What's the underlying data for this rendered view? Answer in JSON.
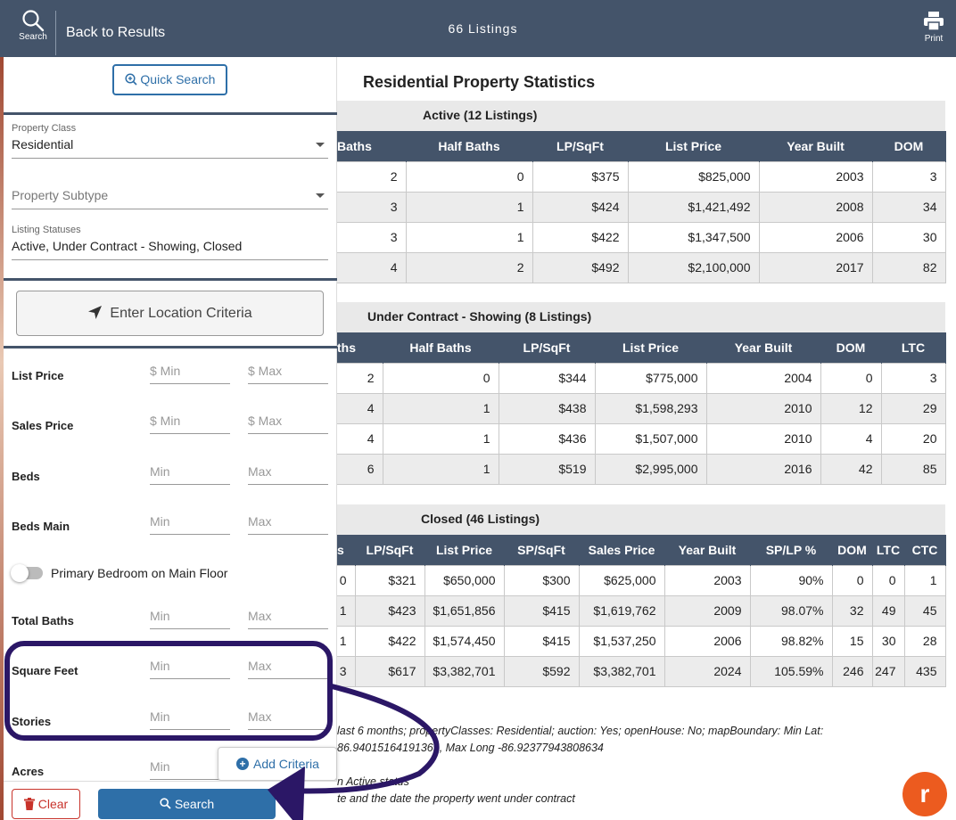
{
  "topbar": {
    "search_label": "Search",
    "back_label": "Back to Results",
    "listing_count": "66 Listings",
    "print_label": "Print"
  },
  "panel": {
    "quick_search": "Quick Search",
    "property_class": {
      "label": "Property Class",
      "value": "Residential"
    },
    "property_subtype": {
      "placeholder": "Property Subtype"
    },
    "listing_statuses": {
      "label": "Listing Statuses",
      "value": "Active, Under Contract - Showing, Closed"
    },
    "location_button": "Enter Location Criteria",
    "ranges": [
      {
        "label": "List Price",
        "min": "$  Min",
        "max": "$  Max"
      },
      {
        "label": "Sales Price",
        "min": "$  Min",
        "max": "$  Max"
      },
      {
        "label": "Beds",
        "min": "Min",
        "max": "Max"
      },
      {
        "label": "Beds Main",
        "min": "Min",
        "max": "Max"
      },
      {
        "label": "Total Baths",
        "min": "Min",
        "max": "Max"
      },
      {
        "label": "Square Feet",
        "min": "Min",
        "max": "Max"
      },
      {
        "label": "Stories",
        "min": "Min",
        "max": "Max"
      },
      {
        "label": "Acres",
        "min": "Min",
        "max": ""
      }
    ],
    "toggle_label": "Primary Bedroom on Main Floor",
    "toggle_on": false,
    "add_criteria": "Add Criteria",
    "clear_button": "Clear",
    "search_button": "Search"
  },
  "report": {
    "title": "Residential Property Statistics",
    "active": {
      "title": "Active (12 Listings)",
      "columns": [
        "Baths",
        "Half Baths",
        "LP/SqFt",
        "List Price",
        "Year Built",
        "DOM"
      ],
      "rows": [
        [
          "2",
          "0",
          "$375",
          "$825,000",
          "2003",
          "3"
        ],
        [
          "3",
          "1",
          "$424",
          "$1,421,492",
          "2008",
          "34"
        ],
        [
          "3",
          "1",
          "$422",
          "$1,347,500",
          "2006",
          "30"
        ],
        [
          "4",
          "2",
          "$492",
          "$2,100,000",
          "2017",
          "82"
        ]
      ]
    },
    "under_contract": {
      "title": "Under Contract - Showing (8 Listings)",
      "columns": [
        "ths",
        "Half Baths",
        "LP/SqFt",
        "List Price",
        "Year Built",
        "DOM",
        "LTC"
      ],
      "rows": [
        [
          "2",
          "0",
          "$344",
          "$775,000",
          "2004",
          "0",
          "3"
        ],
        [
          "4",
          "1",
          "$438",
          "$1,598,293",
          "2010",
          "12",
          "29"
        ],
        [
          "4",
          "1",
          "$436",
          "$1,507,000",
          "2010",
          "4",
          "20"
        ],
        [
          "6",
          "1",
          "$519",
          "$2,995,000",
          "2016",
          "42",
          "85"
        ]
      ]
    },
    "closed": {
      "title": "Closed (46 Listings)",
      "columns": [
        "s",
        "LP/SqFt",
        "List Price",
        "SP/SqFt",
        "Sales Price",
        "Year Built",
        "SP/LP %",
        "DOM",
        "LTC",
        "CTC"
      ],
      "rows": [
        [
          "0",
          "$321",
          "$650,000",
          "$300",
          "$625,000",
          "2003",
          "90%",
          "0",
          "0",
          "1"
        ],
        [
          "1",
          "$423",
          "$1,651,856",
          "$415",
          "$1,619,762",
          "2009",
          "98.07%",
          "32",
          "49",
          "45"
        ],
        [
          "1",
          "$422",
          "$1,574,450",
          "$415",
          "$1,537,250",
          "2006",
          "98.82%",
          "15",
          "30",
          "28"
        ],
        [
          "3",
          "$617",
          "$3,382,701",
          "$592",
          "$3,382,701",
          "2024",
          "105.59%",
          "246",
          "247",
          "435"
        ]
      ]
    },
    "criteria_lines": [
      "last 6 months; propertyClasses: Residential; auction: Yes; openHouse: No; mapBoundary: Min Lat:",
      "86.94015164191369, Max Long -86.92377943808634",
      "",
      "n Active status",
      "te and the date the property went under contract"
    ]
  },
  "colors": {
    "header": "#44546a",
    "accent": "#2e6fa8",
    "danger": "#c8332b",
    "annotation": "#2b1766",
    "logo": "#ec5b1f"
  }
}
